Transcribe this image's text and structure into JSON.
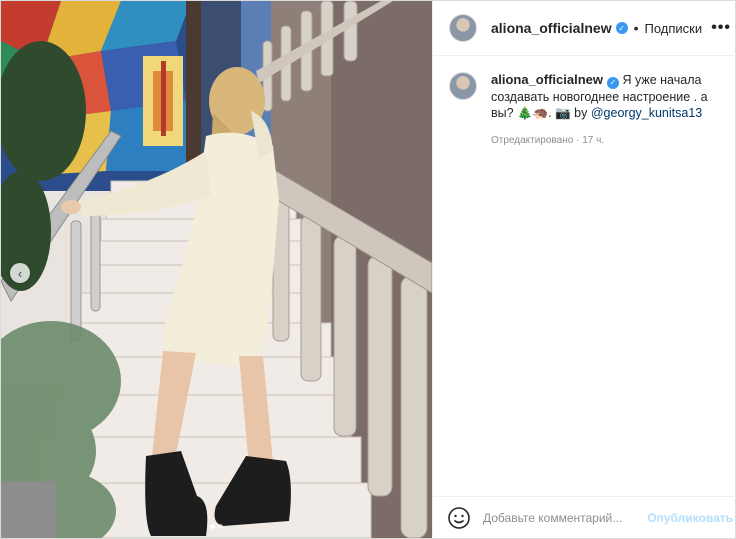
{
  "photo": {
    "alt": "",
    "prev_arrow": "‹",
    "dots_count": 2,
    "active_dot": 0
  },
  "header": {
    "username": "aliona_officialnew",
    "verified_glyph": "✓",
    "separator": "•",
    "follow_status": "Подписки",
    "more_glyph": "•••"
  },
  "caption": {
    "username": "aliona_officialnew",
    "text_1": "Я уже начала создавать новогоднее настроение . а вы?",
    "emojis": "🎄🦔. 📷 by",
    "mention": "@georgy_kunitsa13",
    "edited_label": "Отредактировано",
    "dot": "·",
    "time_ago": "17 ч."
  },
  "footer": {
    "comment_placeholder": "Добавьте комментарий...",
    "publish_label": "Опубликовать"
  },
  "colors": {
    "verified": "#3897f0",
    "publish_disabled": "#b2dffc",
    "mention": "#00376b"
  }
}
